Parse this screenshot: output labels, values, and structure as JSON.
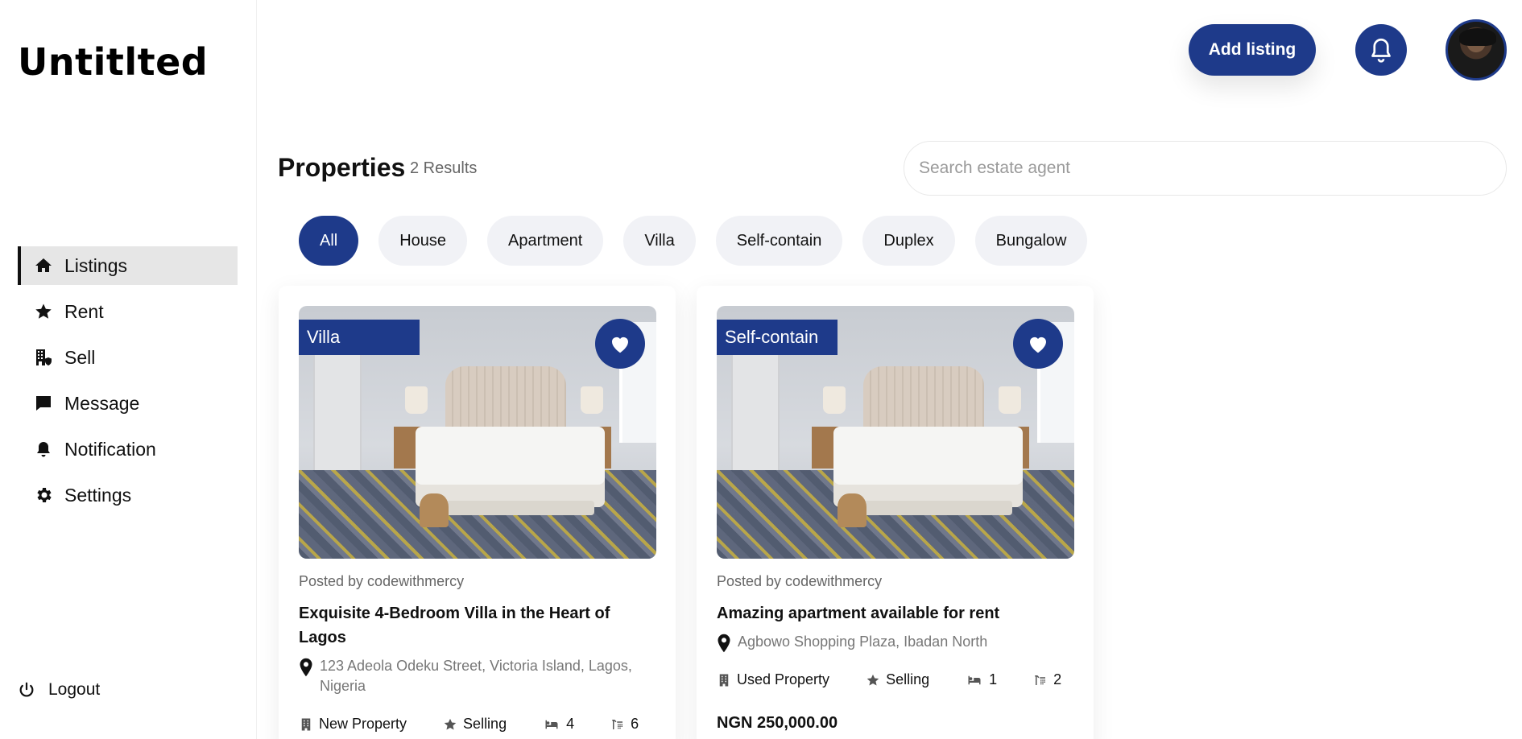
{
  "brand": "Untitlted",
  "sidebar": {
    "items": [
      {
        "label": "Listings",
        "icon": "home-icon"
      },
      {
        "label": "Rent",
        "icon": "star-icon"
      },
      {
        "label": "Sell",
        "icon": "building-icon"
      },
      {
        "label": "Message",
        "icon": "message-icon"
      },
      {
        "label": "Notification",
        "icon": "bell-icon"
      },
      {
        "label": "Settings",
        "icon": "gear-icon"
      }
    ],
    "active_index": 0,
    "logout": "Logout"
  },
  "topbar": {
    "add_listing": "Add listing"
  },
  "main": {
    "title": "Properties",
    "results": "2 Results",
    "search_placeholder": "Search estate agent",
    "filters": [
      "All",
      "House",
      "Apartment",
      "Villa",
      "Self-contain",
      "Duplex",
      "Bungalow"
    ],
    "active_filter": "All"
  },
  "listings": [
    {
      "tag": "Villa",
      "posted_by": "Posted by codewithmercy",
      "title": "Exquisite 4-Bedroom Villa in the Heart of Lagos",
      "location": "123 Adeola Odeku Street, Victoria Island, Lagos, Nigeria",
      "condition": "New Property",
      "status": "Selling",
      "beds": "4",
      "baths": "6",
      "price": ""
    },
    {
      "tag": "Self-contain",
      "posted_by": "Posted by codewithmercy",
      "title": "Amazing apartment available for rent",
      "location": "Agbowo Shopping Plaza, Ibadan North",
      "condition": "Used Property",
      "status": "Selling",
      "beds": "1",
      "baths": "2",
      "price": "NGN 250,000.00"
    }
  ],
  "colors": {
    "accent": "#1e3a8a",
    "chip_bg": "#f1f2f6",
    "active_nav_bg": "#e6e6e6"
  }
}
